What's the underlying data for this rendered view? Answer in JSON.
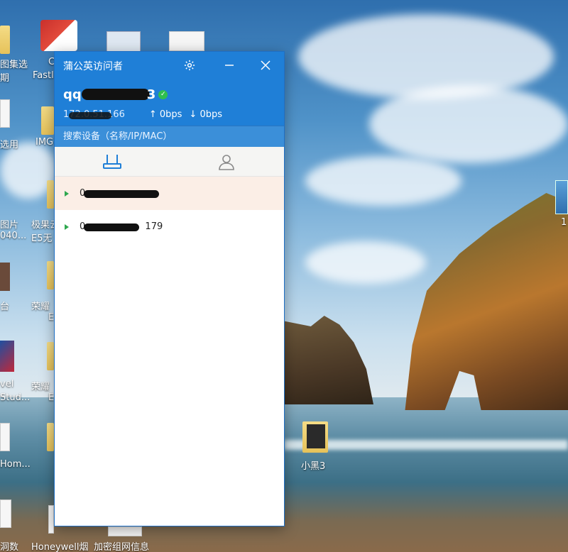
{
  "window": {
    "title": "蒲公英访问者",
    "account_prefix": "qq",
    "account_suffix": "3",
    "online_check": "✓",
    "ip": "172.0.51.166",
    "upload": "↑ 0bps",
    "download": "↓ 0bps",
    "search_placeholder": "搜索设备（名称/IP/MAC）"
  },
  "tabs": [
    {
      "icon": "router-icon",
      "active": true
    },
    {
      "icon": "user-icon",
      "active": false
    }
  ],
  "devices": [
    {
      "name": "0",
      "active": true
    },
    {
      "name": "0",
      "suffix": "179",
      "active": false
    }
  ],
  "desktop": {
    "labels": {
      "l1": "图集选",
      "l1b": "期",
      "l2": "C",
      "l2b": "Fastl",
      "l3": "选用",
      "l4": "IMG",
      "l5": "图片",
      "l5b": "040...",
      "l6": "极果云",
      "l6b": "E5无",
      "l7": "台",
      "l8": "荣耀",
      "l8b": "E",
      "l9": "vel",
      "l9b": "Stud...",
      "l10": "荣耀",
      "l10b": "E",
      "l11": "Hom...",
      "l12": "洞数",
      "l13": "Honeywell烟",
      "l14": "加密组网信息",
      "l15": "小黑3",
      "l16": "1"
    }
  },
  "colors": {
    "header_blue": "#1f7fd7",
    "search_blue": "#3b8fd9",
    "online_green": "#2fbf4f",
    "active_row": "#fbeee6",
    "tab_active": "#1f7fd7",
    "tab_inactive": "#888888"
  }
}
